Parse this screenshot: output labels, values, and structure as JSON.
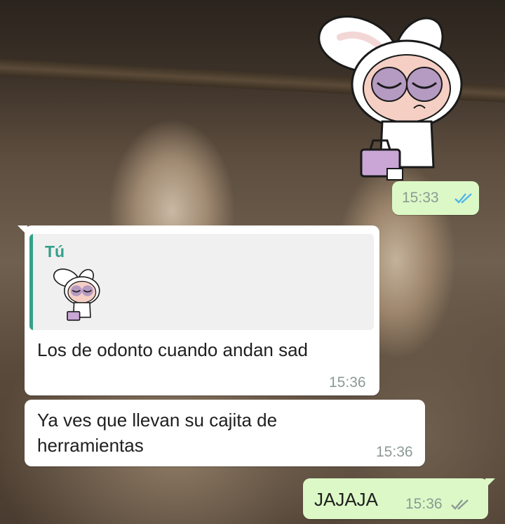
{
  "messages": [
    {
      "type": "sticker",
      "direction": "out",
      "time": "15:33",
      "status": "read"
    },
    {
      "type": "reply",
      "direction": "in",
      "quoted_author": "Tú",
      "quoted_content": "sticker",
      "text": "Los de odonto cuando andan sad",
      "time": "15:36"
    },
    {
      "type": "text",
      "direction": "in",
      "text": "Ya ves que llevan su cajita de herramientas",
      "line1": "Ya ves que llevan su cajita de",
      "line2": "herramientas",
      "time": "15:36"
    },
    {
      "type": "text",
      "direction": "out",
      "text": "JAJAJA",
      "time": "15:36",
      "status": "read"
    }
  ],
  "colors": {
    "incoming_bubble": "#ffffff",
    "outgoing_bubble": "#dcf8c6",
    "reply_accent": "#35a08a",
    "read_ticks": "#4fb6ec",
    "timestamp": "#8b9a93"
  },
  "icons": {
    "read_receipt": "double-check-icon",
    "sticker": "bunny-costume-girl-sticker"
  }
}
